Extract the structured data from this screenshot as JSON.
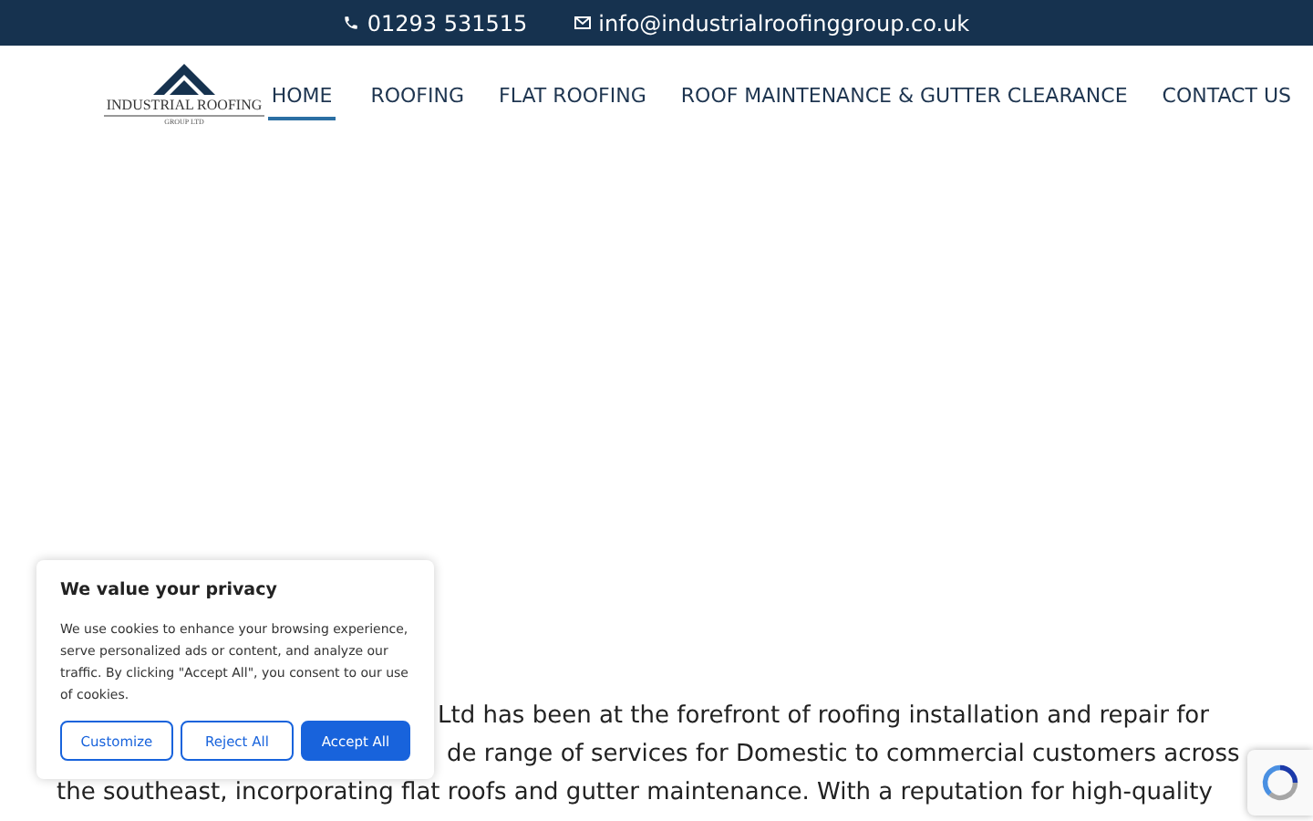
{
  "top_bar": {
    "phone": "01293 531515",
    "email": "info@industrialroofinggroup.co.uk"
  },
  "logo": {
    "name": "INDUSTRIAL ROOFING",
    "subtitle": "GROUP LTD"
  },
  "nav": [
    {
      "label": "HOME",
      "selected": true
    },
    {
      "label": "ROOFING",
      "selected": false
    },
    {
      "label": "FLAT ROOFING",
      "selected": false
    },
    {
      "label": "ROOF MAINTENANCE & GUTTER CLEARANCE",
      "selected": false
    },
    {
      "label": "CONTACT US",
      "selected": false
    }
  ],
  "intro_lines": [
    "Ltd has been at the forefront of roofing installation and repair for",
    "de range of services for Domestic to commercial customers across",
    "the southeast, incorporating flat roofs and gutter maintenance. With a reputation for high-quality"
  ],
  "cookie_banner": {
    "title": "We value your privacy",
    "text": "We use cookies to enhance your browsing experience, serve personalized ads or content, and analyze our traffic. By clicking \"Accept All\", you consent to our use of cookies.",
    "buttons": [
      {
        "label": "Customize",
        "kind": "outline"
      },
      {
        "label": "Reject All",
        "kind": "outline"
      },
      {
        "label": "Accept All",
        "kind": "primary"
      }
    ]
  }
}
